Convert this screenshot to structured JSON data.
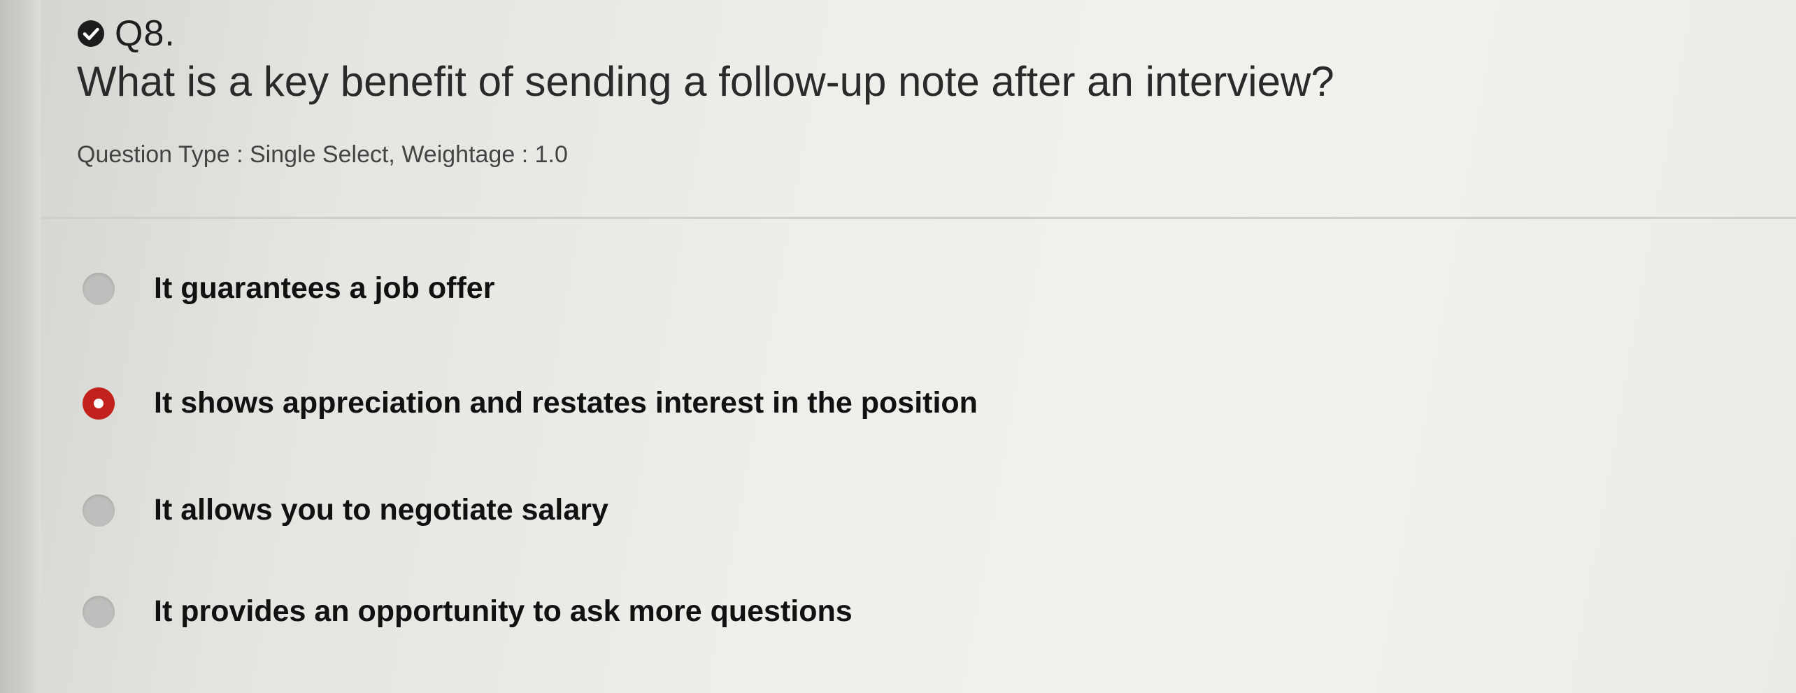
{
  "question": {
    "number": "Q8.",
    "text": "What is a key benefit of sending a follow-up note after an interview?",
    "meta": "Question Type : Single Select, Weightage : 1.0",
    "status_icon": "check-circle-icon",
    "status_color": "#1c1c1c"
  },
  "options": [
    {
      "label": "It guarantees a job offer",
      "selected": false
    },
    {
      "label": "It shows appreciation and restates interest in the position",
      "selected": true
    },
    {
      "label": "It allows you to negotiate salary",
      "selected": false
    },
    {
      "label": "It provides an opportunity to ask more questions",
      "selected": false
    }
  ],
  "colors": {
    "selected_radio": "#c2211c",
    "unselected_radio": "#bdbfbc"
  }
}
